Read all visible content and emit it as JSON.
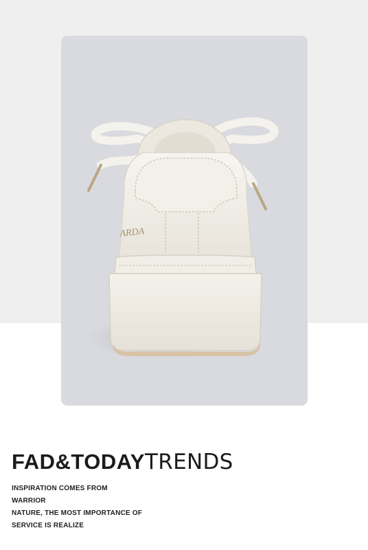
{
  "colors": {
    "page_bg_top": "#efefef",
    "page_bg_bottom": "#ffffff",
    "card_bg": "#d9dadf",
    "shoe": "#f1efea",
    "sole_edge": "#d8c2a4",
    "text": "#1b1b1b"
  },
  "photo": {
    "subject": "white-sneaker-back-view",
    "heel_logo_text": "ARDA"
  },
  "headline": {
    "part1": "FAD",
    "part2": "&",
    "part3": "TODAY",
    "part4": "TRENDS"
  },
  "body_lines": [
    "INSPIRATION COMES FROM",
    "WARRIOR",
    "NATURE, THE MOST IMPORTANCE OF",
    "SERVICE IS REALIZE"
  ]
}
